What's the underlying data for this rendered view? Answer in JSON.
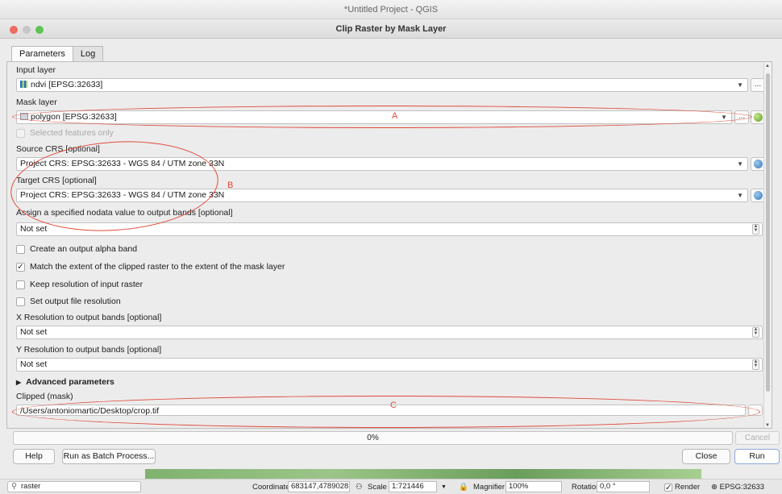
{
  "app": {
    "window_title": "*Untitled Project - QGIS"
  },
  "dialog": {
    "title": "Clip Raster by Mask Layer"
  },
  "tabs": [
    {
      "label": "Parameters"
    },
    {
      "label": "Log"
    }
  ],
  "params": {
    "input_layer_label": "Input layer",
    "input_layer_value": "ndvi [EPSG:32633]",
    "mask_layer_label": "Mask layer",
    "mask_layer_value": "polygon [EPSG:32633]",
    "selected_features_label": "Selected features only",
    "source_crs_label": "Source CRS [optional]",
    "source_crs_value": "Project CRS: EPSG:32633 - WGS 84 / UTM zone 33N",
    "target_crs_label": "Target CRS [optional]",
    "target_crs_value": "Project CRS: EPSG:32633 - WGS 84 / UTM zone 33N",
    "nodata_label": "Assign a specified nodata value to output bands [optional]",
    "nodata_value": "Not set",
    "alpha_band_label": "Create an output alpha band",
    "match_extent_label": "Match the extent of the clipped raster to the extent of the mask layer",
    "keep_resolution_label": "Keep resolution of input raster",
    "set_resolution_label": "Set output file resolution",
    "x_res_label": "X Resolution to output bands [optional]",
    "x_res_value": "Not set",
    "y_res_label": "Y Resolution to output bands [optional]",
    "y_res_value": "Not set",
    "advanced_label": "Advanced parameters",
    "output_label": "Clipped (mask)",
    "output_value": "/Users/antoniomartic/Desktop/crop.tif"
  },
  "checkboxes": {
    "alpha_band": false,
    "match_extent": true,
    "keep_resolution": false,
    "set_resolution": false,
    "selected_features": false
  },
  "annotations": {
    "a": "A",
    "b": "B",
    "c": "C"
  },
  "progress": {
    "text": "0%",
    "value": 0
  },
  "buttons": {
    "cancel": "Cancel",
    "help": "Help",
    "batch": "Run as Batch Process...",
    "close": "Close",
    "run": "Run",
    "browse": "..."
  },
  "statusbar": {
    "search_value": "raster",
    "coordinate_label": "Coordinate",
    "coordinate_value": "683147,4789028",
    "scale_label": "Scale",
    "scale_value": "1:721446",
    "magnifier_label": "Magnifier",
    "magnifier_value": "100%",
    "rotation_label": "Rotation",
    "rotation_value": "0,0 °",
    "render_label": "Render",
    "crs_value": "EPSG:32633"
  },
  "colors": {
    "annotation": "#e04a3a",
    "traffic_close": "#ee6a5f",
    "traffic_max": "#5fc454"
  }
}
